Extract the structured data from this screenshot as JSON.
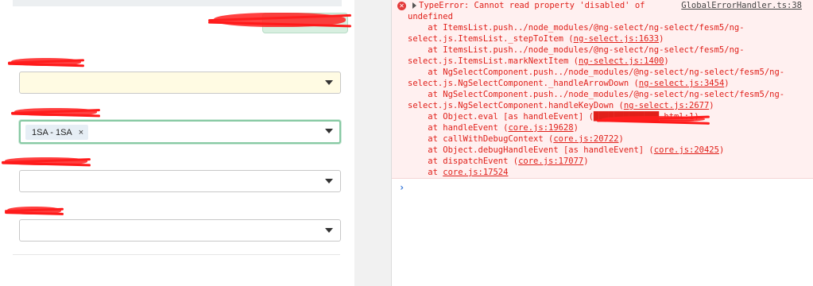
{
  "form": {
    "field2_chip": "1SA - 1SA",
    "chip_remove": "×"
  },
  "console": {
    "error_title": "TypeError: Cannot read property 'disabled' of",
    "error_source": "GlobalErrorHandler.ts:38",
    "error_icon": "✕",
    "lines": [
      {
        "text": "undefined",
        "loc": "",
        "tail": ""
      },
      {
        "text": "    at ItemsList.push../node_modules/@ng-select/ng-select/fesm5/ng-",
        "loc": "",
        "tail": ""
      },
      {
        "text": "select.js.ItemsList._stepToItem (",
        "loc": "ng-select.js:1633",
        "tail": ")"
      },
      {
        "text": "    at ItemsList.push../node_modules/@ng-select/ng-select/fesm5/ng-",
        "loc": "",
        "tail": ""
      },
      {
        "text": "select.js.ItemsList.markNextItem (",
        "loc": "ng-select.js:1400",
        "tail": ")"
      },
      {
        "text": "    at NgSelectComponent.push../node_modules/@ng-select/ng-select/fesm5/ng-",
        "loc": "",
        "tail": ""
      },
      {
        "text": "select.js.NgSelectComponent._handleArrowDown (",
        "loc": "ng-select.js:3454",
        "tail": ")"
      },
      {
        "text": "    at NgSelectComponent.push../node_modules/@ng-select/ng-select/fesm5/ng-",
        "loc": "",
        "tail": ""
      },
      {
        "text": "select.js.NgSelectComponent.handleKeyDown (",
        "loc": "ng-select.js:2677",
        "tail": ")"
      },
      {
        "text": "    at Object.eval [as handleEvent] (",
        "loc": "█████████████.html:1",
        "tail": ")"
      },
      {
        "text": "    at handleEvent (",
        "loc": "core.js:19628",
        "tail": ")"
      },
      {
        "text": "    at callWithDebugContext (",
        "loc": "core.js:20722",
        "tail": ")"
      },
      {
        "text": "    at Object.debugHandleEvent [as handleEvent] (",
        "loc": "core.js:20425",
        "tail": ")"
      },
      {
        "text": "    at dispatchEvent (",
        "loc": "core.js:17077",
        "tail": ")"
      },
      {
        "text": "    at ",
        "loc": "core.js:17524",
        "tail": ""
      }
    ],
    "prompt": "›"
  },
  "colors": {
    "error_text": "#e0201a",
    "error_bg": "#fff0f0",
    "focus_border": "#87c9a3",
    "warn_bg": "#fffbe3",
    "prompt": "#2a6fd6"
  }
}
